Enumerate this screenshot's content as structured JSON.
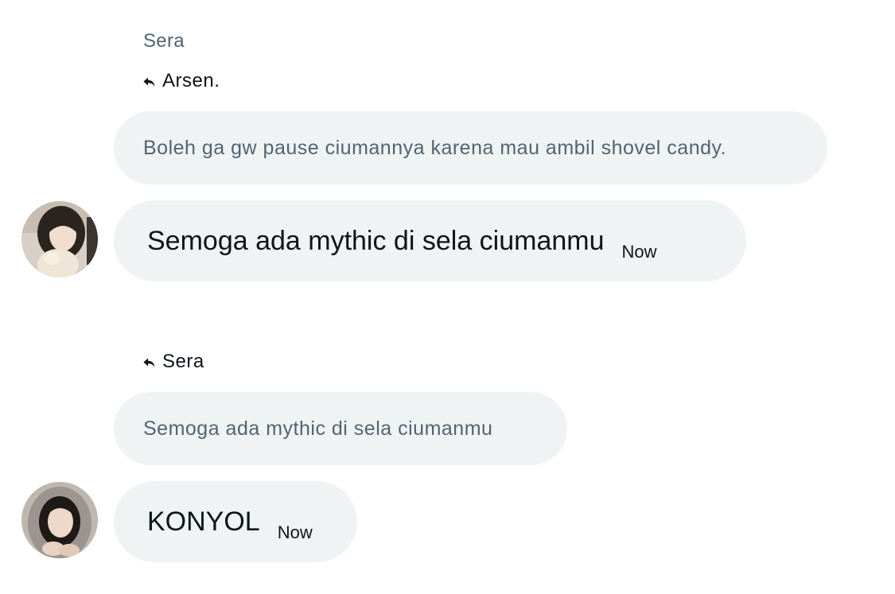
{
  "thread": [
    {
      "sender_name": "Sera",
      "reply_to": "Arsen.",
      "quoted_text": "Boleh ga gw pause ciumannya karena mau ambil shovel candy.",
      "message": "Semoga ada mythic di sela ciumanmu",
      "time": "Now",
      "avatar_icon": "avatar-photo"
    },
    {
      "sender_name": "",
      "reply_to": "Sera",
      "quoted_text": "Semoga ada mythic di sela ciumanmu",
      "message": "KONYOL",
      "time": "Now",
      "avatar_icon": "avatar-photo"
    }
  ],
  "colors": {
    "bubble": "#eff3f4",
    "muted_text": "#536471",
    "text": "#0f1419"
  }
}
